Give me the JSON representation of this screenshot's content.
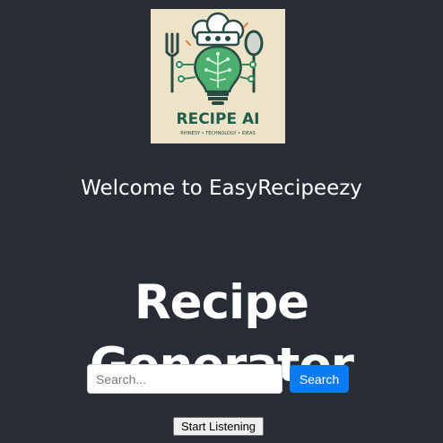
{
  "logo": {
    "brand_text": "RECIPE AI",
    "tagline": "RHINESY • TECHNOLOGY • IDEAS"
  },
  "header": {
    "welcome": "Welcome to EasyRecipeezy"
  },
  "main": {
    "title": "Recipe Generator"
  },
  "search": {
    "placeholder": "Search...",
    "value": "",
    "button_label": "Search"
  },
  "voice": {
    "button_label": "Start Listening"
  },
  "colors": {
    "background": "#282c35",
    "accent": "#0a7cf3",
    "logo_green": "#2e8b57"
  }
}
